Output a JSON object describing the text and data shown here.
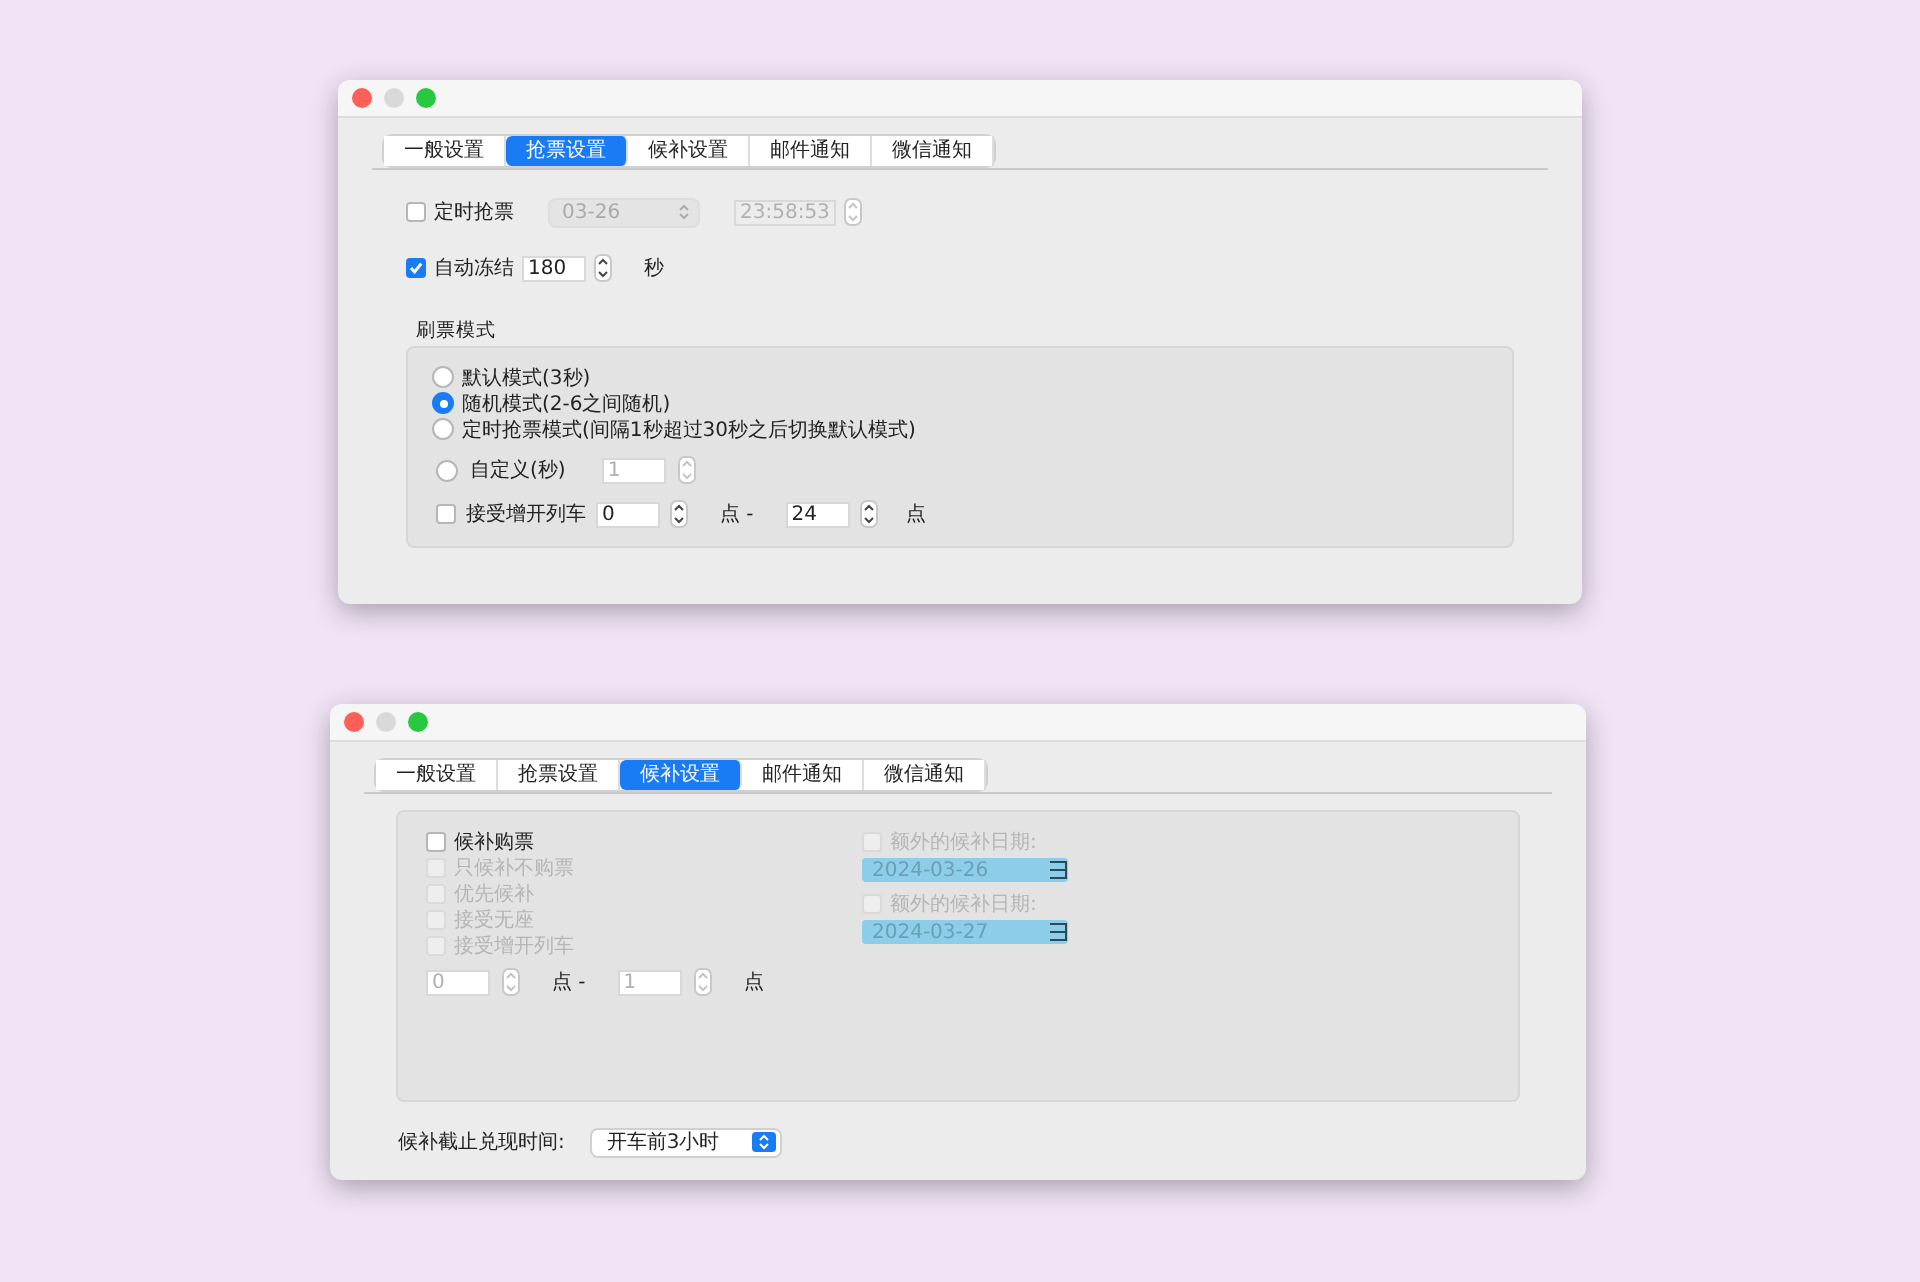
{
  "grab_window": {
    "tabs": [
      {
        "label": "一般设置",
        "selected": false
      },
      {
        "label": "抢票设置",
        "selected": true
      },
      {
        "label": "候补设置",
        "selected": false
      },
      {
        "label": "邮件通知",
        "selected": false
      },
      {
        "label": "微信通知",
        "selected": false
      }
    ],
    "timed": {
      "label": "定时抢票",
      "checked": false,
      "date": "03-26",
      "time": "23:58:53",
      "disabled": true
    },
    "auto_freeze": {
      "label": "自动冻结",
      "checked": true,
      "value": "180",
      "unit": "秒"
    },
    "mode_group": {
      "title": "刷票模式",
      "options": [
        {
          "label": "默认模式(3秒)",
          "selected": false
        },
        {
          "label": "随机模式(2-6之间随机)",
          "selected": true
        },
        {
          "label": "定时抢票模式(间隔1秒超过30秒之后切换默认模式)",
          "selected": false
        }
      ],
      "custom": {
        "label": "自定义(秒)",
        "selected": false,
        "value": "1",
        "disabled": true
      },
      "extra_trains": {
        "label": "接受增开列车",
        "checked": false,
        "from": "0",
        "separator": "点 -",
        "to": "24",
        "unit": "点"
      }
    }
  },
  "waitlist_window": {
    "tabs": [
      {
        "label": "一般设置",
        "selected": false
      },
      {
        "label": "抢票设置",
        "selected": false
      },
      {
        "label": "候补设置",
        "selected": true
      },
      {
        "label": "邮件通知",
        "selected": false
      },
      {
        "label": "微信通知",
        "selected": false
      }
    ],
    "options": [
      {
        "label": "候补购票",
        "checked": false,
        "disabled": false
      },
      {
        "label": "只候补不购票",
        "checked": false,
        "disabled": true
      },
      {
        "label": "优先候补",
        "checked": false,
        "disabled": true
      },
      {
        "label": "接受无座",
        "checked": false,
        "disabled": true
      },
      {
        "label": "接受增开列车",
        "checked": false,
        "disabled": true
      }
    ],
    "range": {
      "from": "0",
      "separator": "点 -",
      "to": "1",
      "unit": "点",
      "disabled": true
    },
    "extra_dates": [
      {
        "label": "额外的候补日期:",
        "checked": false,
        "disabled": true,
        "date": "2024-03-26"
      },
      {
        "label": "额外的候补日期:",
        "checked": false,
        "disabled": true,
        "date": "2024-03-27"
      }
    ],
    "deadline": {
      "label": "候补截止兑现时间:",
      "value": "开车前3小时"
    }
  }
}
